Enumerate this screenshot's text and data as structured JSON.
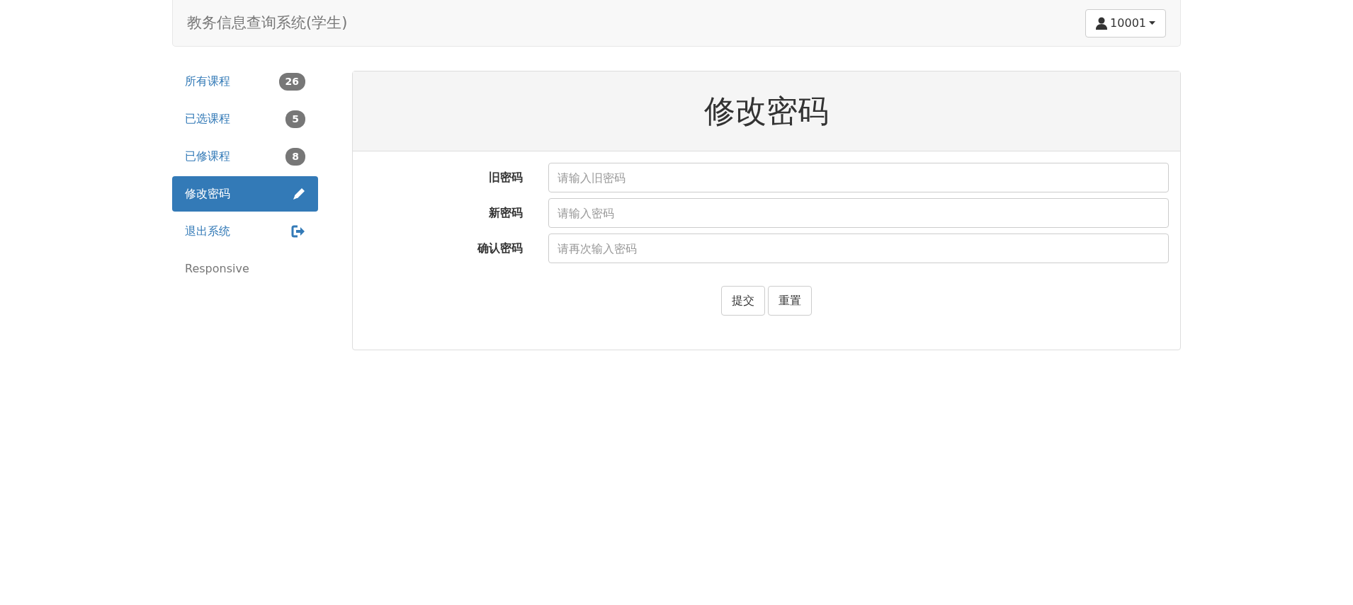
{
  "navbar": {
    "brand": "教务信息查询系统(学生)",
    "user_menu": "10001"
  },
  "sidebar": {
    "items": [
      {
        "label": "所有课程",
        "kind": "badge",
        "badge": "26",
        "selected": false
      },
      {
        "label": "已选课程",
        "kind": "badge",
        "badge": "5",
        "selected": false
      },
      {
        "label": "已修课程",
        "kind": "badge",
        "badge": "8",
        "selected": false
      },
      {
        "label": "修改密码",
        "kind": "edit",
        "selected": true
      },
      {
        "label": "退出系统",
        "kind": "logout",
        "selected": false
      },
      {
        "label": "Responsive",
        "kind": "plain",
        "selected": false
      }
    ]
  },
  "panel": {
    "title": "修改密码",
    "fields": [
      {
        "label": "旧密码",
        "placeholder": "请输入旧密码"
      },
      {
        "label": "新密码",
        "placeholder": "请输入密码"
      },
      {
        "label": "确认密码",
        "placeholder": "请再次输入密码"
      }
    ],
    "buttons": [
      "提交",
      "重置"
    ]
  }
}
